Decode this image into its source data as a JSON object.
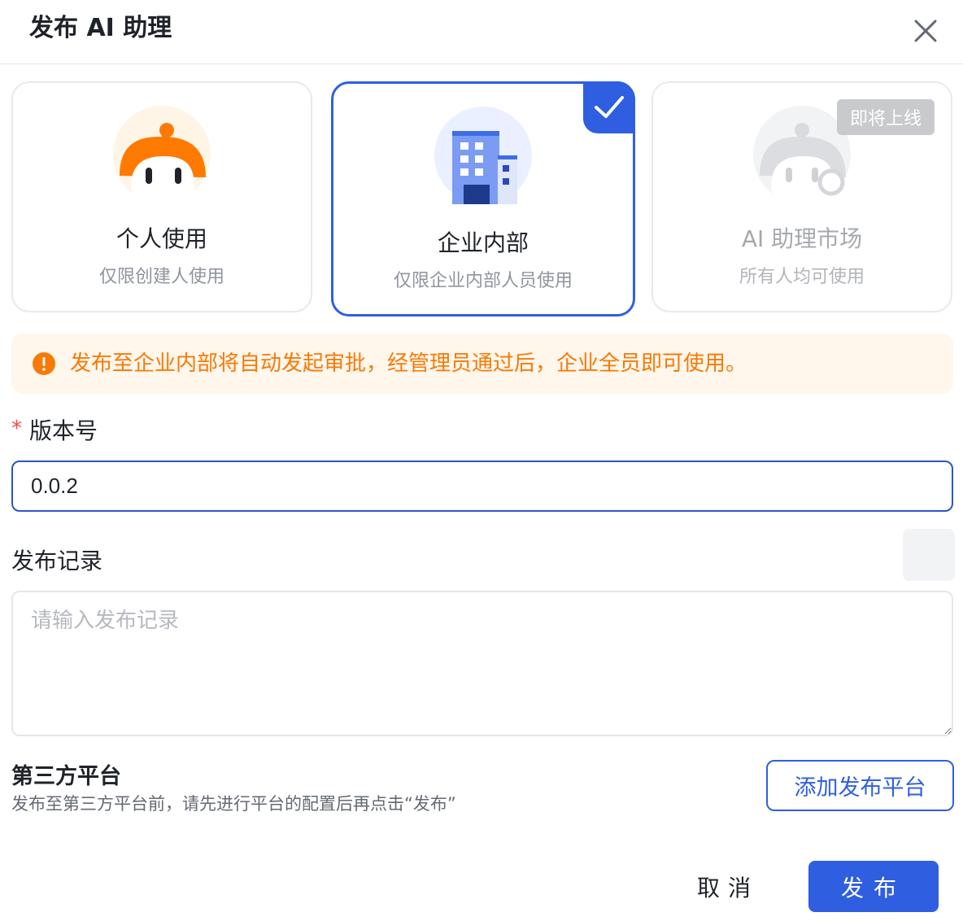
{
  "dialog": {
    "title": "发布 AI 助理"
  },
  "options": [
    {
      "name": "个人使用",
      "desc": "仅限创建人使用"
    },
    {
      "name": "企业内部",
      "desc": "仅限企业内部人员使用",
      "selected": true
    },
    {
      "name": "AI 助理市场",
      "desc": "所有人均可使用",
      "badge": "即将上线",
      "disabled": true
    }
  ],
  "alert": {
    "text": "发布至企业内部将自动发起审批，经管理员通过后，企业全员即可使用。"
  },
  "form": {
    "version_required_mark": "*",
    "version_label": "版本号",
    "version_value": "0.0.2",
    "notes_label": "发布记录",
    "notes_placeholder": "请输入发布记录"
  },
  "third_party": {
    "title": "第三方平台",
    "desc": "发布至第三方平台前，请先进行平台的配置后再点击“发布”",
    "add_button": "添加发布平台"
  },
  "footer": {
    "cancel": "取消",
    "publish": "发布"
  },
  "colors": {
    "primary": "#2f5fe0",
    "warning": "#f77a06",
    "warning_bg": "#fff6ec",
    "required": "#f54a45"
  }
}
